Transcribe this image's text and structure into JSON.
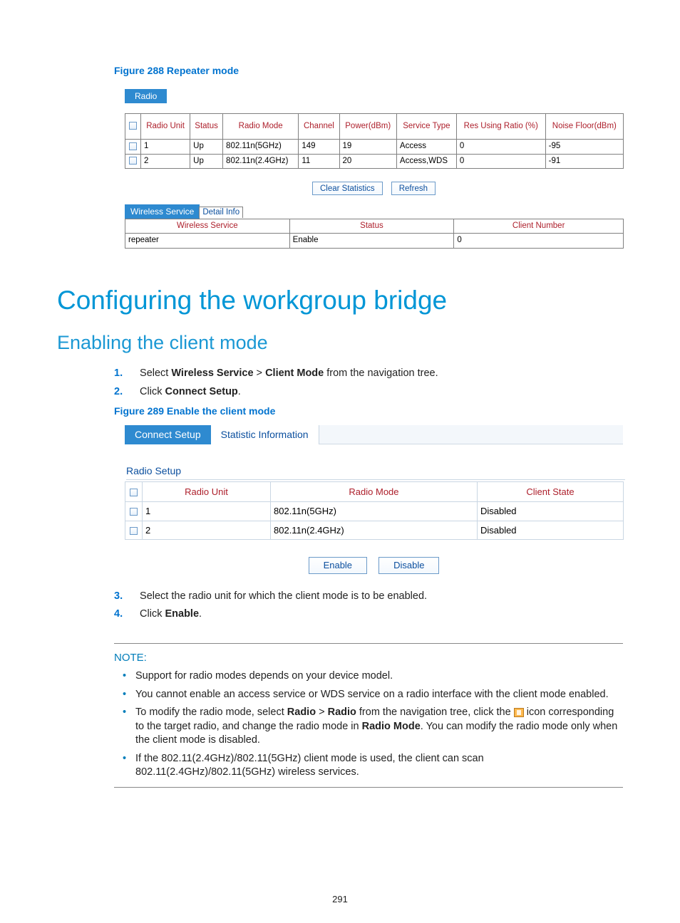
{
  "figure288": {
    "caption": "Figure 288 Repeater mode",
    "tab": "Radio",
    "headers": {
      "chk": "",
      "radio_unit": "Radio Unit",
      "status": "Status",
      "radio_mode": "Radio Mode",
      "channel": "Channel",
      "power": "Power(dBm)",
      "service_type": "Service Type",
      "res_ratio": "Res Using Ratio (%)",
      "noise": "Noise Floor(dBm)"
    },
    "rows": [
      {
        "unit": "1",
        "status": "Up",
        "mode": "802.11n(5GHz)",
        "channel": "149",
        "power": "19",
        "service": "Access",
        "ratio": "0",
        "noise": "-95"
      },
      {
        "unit": "2",
        "status": "Up",
        "mode": "802.11n(2.4GHz)",
        "channel": "11",
        "power": "20",
        "service": "Access,WDS",
        "ratio": "0",
        "noise": "-91"
      }
    ],
    "buttons": {
      "clear": "Clear Statistics",
      "refresh": "Refresh"
    },
    "tabs2": {
      "active": "Wireless Service",
      "inactive": "Detail Info"
    },
    "ws": {
      "headers": {
        "service": "Wireless Service",
        "status": "Status",
        "clients": "Client Number"
      },
      "row": {
        "service": "repeater",
        "status": "Enable",
        "clients": "0"
      }
    }
  },
  "h1": "Configuring the workgroup bridge",
  "h2": "Enabling the client mode",
  "steps": {
    "s1_a": "Select ",
    "s1_b": "Wireless Service",
    "s1_c": " > ",
    "s1_d": "Client Mode",
    "s1_e": " from the navigation tree.",
    "s2_a": "Click ",
    "s2_b": "Connect Setup",
    "s2_c": ".",
    "s3": "Select the radio unit for which the client mode is to be enabled.",
    "s4_a": "Click ",
    "s4_b": "Enable",
    "s4_c": "."
  },
  "figure289": {
    "caption": "Figure 289 Enable the client mode",
    "tabs": {
      "on": "Connect Setup",
      "off": "Statistic Information"
    },
    "section": "Radio Setup",
    "headers": {
      "unit": "Radio Unit",
      "mode": "Radio Mode",
      "state": "Client State"
    },
    "rows": [
      {
        "unit": "1",
        "mode": "802.11n(5GHz)",
        "state": "Disabled"
      },
      {
        "unit": "2",
        "mode": "802.11n(2.4GHz)",
        "state": "Disabled"
      }
    ],
    "buttons": {
      "enable": "Enable",
      "disable": "Disable"
    }
  },
  "note": {
    "head": "NOTE:",
    "b1": "Support for radio modes depends on your device model.",
    "b2": "You cannot enable an access service or WDS service on a radio interface with the client mode enabled.",
    "b3_a": "To modify the radio mode, select ",
    "b3_b": "Radio",
    "b3_c": " > ",
    "b3_d": "Radio",
    "b3_e": " from the navigation tree, click the ",
    "b3_f": " icon corresponding to the target radio, and change the radio mode in ",
    "b3_g": "Radio Mode",
    "b3_h": ". You can modify the radio mode only when the client mode is disabled.",
    "b4": "If the 802.11(2.4GHz)/802.11(5GHz) client mode is used, the client can scan 802.11(2.4GHz)/802.11(5GHz) wireless services."
  },
  "page_number": "291",
  "nums": {
    "n1": "1.",
    "n2": "2.",
    "n3": "3.",
    "n4": "4."
  }
}
